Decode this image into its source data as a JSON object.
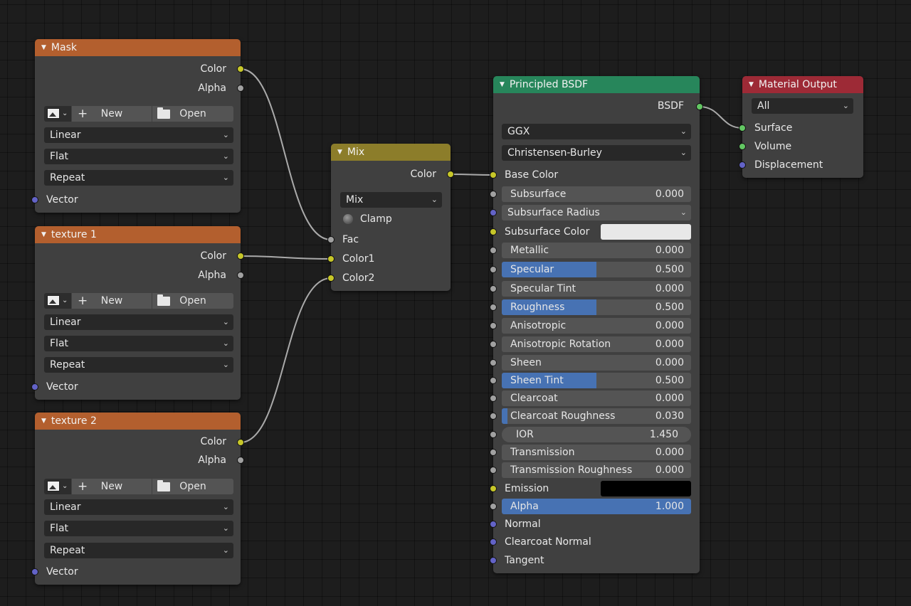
{
  "colors": {
    "texture_header": "#b35f2e",
    "mix_header": "#8c7d2a",
    "shader_header": "#27865b",
    "output_header": "#9d2a36",
    "link": "#aaaaaa",
    "accent": "#4772b3"
  },
  "mask": {
    "title": "Mask",
    "out_color": "Color",
    "out_alpha": "Alpha",
    "new": "New",
    "open": "Open",
    "interpolation": "Linear",
    "projection": "Flat",
    "extension": "Repeat",
    "in_vector": "Vector"
  },
  "texture1": {
    "title": "texture 1",
    "out_color": "Color",
    "out_alpha": "Alpha",
    "new": "New",
    "open": "Open",
    "interpolation": "Linear",
    "projection": "Flat",
    "extension": "Repeat",
    "in_vector": "Vector"
  },
  "texture2": {
    "title": "texture 2",
    "out_color": "Color",
    "out_alpha": "Alpha",
    "new": "New",
    "open": "Open",
    "interpolation": "Linear",
    "projection": "Flat",
    "extension": "Repeat",
    "in_vector": "Vector"
  },
  "mix": {
    "title": "Mix",
    "out_color": "Color",
    "blend": "Mix",
    "clamp": "Clamp",
    "clamp_enabled": false,
    "in_fac": "Fac",
    "in_color1": "Color1",
    "in_color2": "Color2"
  },
  "bsdf": {
    "title": "Principled BSDF",
    "out": "BSDF",
    "distribution": "GGX",
    "subsurface_method": "Christensen-Burley",
    "base_color": "Base Color",
    "subsurface": {
      "label": "Subsurface",
      "value": "0.000",
      "fill": 0
    },
    "subsurface_radius": "Subsurface Radius",
    "subsurface_color": {
      "label": "Subsurface Color",
      "color": "#e8e8e8"
    },
    "metallic": {
      "label": "Metallic",
      "value": "0.000",
      "fill": 0
    },
    "specular": {
      "label": "Specular",
      "value": "0.500",
      "fill": 0.5
    },
    "specular_tint": {
      "label": "Specular Tint",
      "value": "0.000",
      "fill": 0
    },
    "roughness": {
      "label": "Roughness",
      "value": "0.500",
      "fill": 0.5
    },
    "anisotropic": {
      "label": "Anisotropic",
      "value": "0.000",
      "fill": 0
    },
    "anisotropic_rotation": {
      "label": "Anisotropic Rotation",
      "value": "0.000",
      "fill": 0
    },
    "sheen": {
      "label": "Sheen",
      "value": "0.000",
      "fill": 0
    },
    "sheen_tint": {
      "label": "Sheen Tint",
      "value": "0.500",
      "fill": 0.5
    },
    "clearcoat": {
      "label": "Clearcoat",
      "value": "0.000",
      "fill": 0
    },
    "clearcoat_roughness": {
      "label": "Clearcoat Roughness",
      "value": "0.030",
      "fill": 0.03
    },
    "ior": {
      "label": "IOR",
      "value": "1.450"
    },
    "transmission": {
      "label": "Transmission",
      "value": "0.000",
      "fill": 0
    },
    "transmission_roughness": {
      "label": "Transmission Roughness",
      "value": "0.000",
      "fill": 0
    },
    "emission": {
      "label": "Emission",
      "color": "#000000"
    },
    "alpha": {
      "label": "Alpha",
      "value": "1.000",
      "fill": 1
    },
    "normal": "Normal",
    "clearcoat_normal": "Clearcoat Normal",
    "tangent": "Tangent"
  },
  "output": {
    "title": "Material Output",
    "target": "All",
    "surface": "Surface",
    "volume": "Volume",
    "displacement": "Displacement"
  }
}
